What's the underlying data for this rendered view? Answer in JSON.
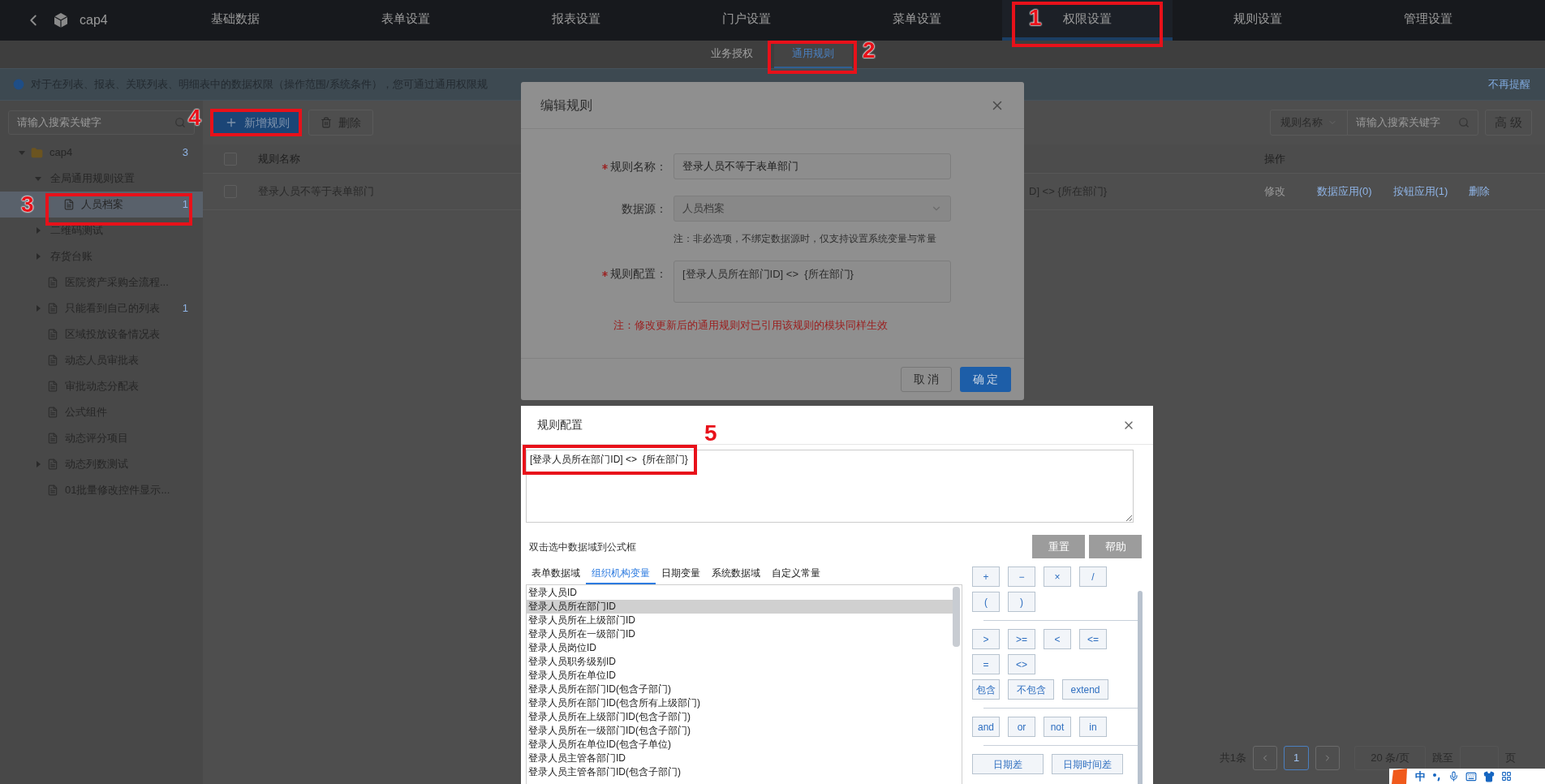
{
  "topbar": {
    "app_name": "cap4",
    "nav": [
      {
        "label": "基础数据",
        "selected": false
      },
      {
        "label": "表单设置",
        "selected": false
      },
      {
        "label": "报表设置",
        "selected": false
      },
      {
        "label": "门户设置",
        "selected": false
      },
      {
        "label": "菜单设置",
        "selected": false
      },
      {
        "label": "权限设置",
        "selected": true
      },
      {
        "label": "规则设置",
        "selected": false
      },
      {
        "label": "管理设置",
        "selected": false
      }
    ]
  },
  "subtabs": [
    {
      "label": "业务授权",
      "selected": false
    },
    {
      "label": "通用规则",
      "selected": true
    }
  ],
  "info_bar": {
    "text": "对于在列表、报表、关联列表、明细表中的数据权限（操作范围/系统条件），您可通过通用权限规",
    "dismiss": "不再提醒"
  },
  "sidebar": {
    "search_placeholder": "请输入搜索关键字",
    "tree": [
      {
        "label": "cap4",
        "kind": "folder",
        "count": "3",
        "expanded": true,
        "selected": false,
        "children": [
          {
            "label": "全局通用规则设置",
            "kind": "group",
            "expanded": true,
            "selected": false,
            "children": [
              {
                "label": "人员档案",
                "kind": "doc",
                "count": "1",
                "selected": true
              }
            ]
          },
          {
            "label": "二维码测试",
            "kind": "group",
            "expanded": false,
            "selected": false
          },
          {
            "label": "存货台账",
            "kind": "group",
            "expanded": false,
            "selected": false
          },
          {
            "label": "医院资产采购全流程...",
            "kind": "doc",
            "selected": false
          },
          {
            "label": "只能看到自己的列表",
            "kind": "doc",
            "count": "1",
            "expanded": false,
            "selected": false
          },
          {
            "label": "区域投放设备情况表",
            "kind": "doc",
            "selected": false
          },
          {
            "label": "动态人员审批表",
            "kind": "doc",
            "selected": false
          },
          {
            "label": "审批动态分配表",
            "kind": "doc",
            "selected": false
          },
          {
            "label": "公式组件",
            "kind": "doc",
            "selected": false
          },
          {
            "label": "动态评分项目",
            "kind": "doc",
            "selected": false
          },
          {
            "label": "动态列数测试",
            "kind": "doc",
            "expanded": false,
            "selected": false
          },
          {
            "label": "01批量修改控件显示...",
            "kind": "doc",
            "selected": false
          }
        ]
      }
    ]
  },
  "toolbar": {
    "add_button": "新增规则",
    "delete_button": "删除",
    "search_scope": "规则名称",
    "search_placeholder": "请输入搜索关键字",
    "advanced_button": "高 级"
  },
  "table": {
    "header_checked": false,
    "columns": [
      {
        "label": "规则名称"
      },
      {
        "label": "操作"
      }
    ],
    "rows": [
      {
        "checked": false,
        "name": "登录人员不等于表单部门",
        "column_3": "D] <> {所在部门}",
        "actions": [
          {
            "label": "修改",
            "disabled": true
          },
          {
            "label": "数据应用(0)",
            "disabled": false
          },
          {
            "label": "按钮应用(1)",
            "disabled": false
          },
          {
            "label": "删除",
            "disabled": false
          }
        ]
      }
    ]
  },
  "pagination": {
    "total": "共1条",
    "pages": [
      {
        "label": "1",
        "selected": true
      }
    ],
    "page_size": "20 条/页",
    "jump_label": "跳至",
    "page_suffix": "页"
  },
  "edit_dialog": {
    "title": "编辑规则",
    "fields": [
      {
        "label": "规则名称：",
        "required": true,
        "kind": "input",
        "value": "登录人员不等于表单部门"
      },
      {
        "label": "数据源：",
        "required": false,
        "kind": "select",
        "value": "人员档案",
        "disabled": true,
        "hint": "注：非必选项，不绑定数据源时，仅支持设置系统变量与常量"
      },
      {
        "label": "规则配置：",
        "required": true,
        "kind": "textarea",
        "value": "[登录人员所在部门ID] <>  {所在部门}"
      }
    ],
    "note": "注：修改更新后的通用规则对已引用该规则的模块同样生效",
    "buttons": [
      {
        "label": "取 消",
        "primary": false
      },
      {
        "label": "确 定",
        "primary": true
      }
    ]
  },
  "config_dialog": {
    "title": "规则配置",
    "formula": "[登录人员所在部门ID] <>  {所在部门}",
    "hint": "双击选中数据域到公式框",
    "buttons": [
      "重置",
      "帮助"
    ],
    "tabs": [
      {
        "label": "表单数据域",
        "selected": false
      },
      {
        "label": "组织机构变量",
        "selected": true
      },
      {
        "label": "日期变量",
        "selected": false
      },
      {
        "label": "系统数据域",
        "selected": false
      },
      {
        "label": "自定义常量",
        "selected": false
      }
    ],
    "fields": [
      {
        "label": "登录人员ID",
        "selected": false
      },
      {
        "label": "登录人员所在部门ID",
        "selected": true
      },
      {
        "label": "登录人员所在上级部门ID",
        "selected": false
      },
      {
        "label": "登录人员所在一级部门ID",
        "selected": false
      },
      {
        "label": "登录人员岗位ID",
        "selected": false
      },
      {
        "label": "登录人员职务级别ID",
        "selected": false
      },
      {
        "label": "登录人员所在单位ID",
        "selected": false
      },
      {
        "label": "登录人员所在部门ID(包含子部门)",
        "selected": false
      },
      {
        "label": "登录人员所在部门ID(包含所有上级部门)",
        "selected": false
      },
      {
        "label": "登录人员所在上级部门ID(包含子部门)",
        "selected": false
      },
      {
        "label": "登录人员所在一级部门ID(包含子部门)",
        "selected": false
      },
      {
        "label": "登录人员所在单位ID(包含子单位)",
        "selected": false
      },
      {
        "label": "登录人员主管各部门ID",
        "selected": false
      },
      {
        "label": "登录人员主管各部门ID(包含子部门)",
        "selected": false
      }
    ],
    "operator_groups": [
      [
        [
          "+",
          "−",
          "×",
          "/"
        ],
        [
          "(",
          ")"
        ]
      ],
      [
        [
          ">",
          ">=",
          "<",
          "<="
        ],
        [
          "=",
          "<>"
        ],
        [
          "包含",
          "不包含",
          "extend"
        ]
      ],
      [
        [
          "and",
          "or",
          "not",
          "in"
        ]
      ],
      [
        [
          "日期差",
          "日期时间差"
        ]
      ]
    ]
  },
  "ime_bar": {
    "label": "中"
  },
  "annotations": [
    {
      "number": "1"
    },
    {
      "number": "2"
    },
    {
      "number": "3"
    },
    {
      "number": "4"
    },
    {
      "number": "5"
    }
  ]
}
